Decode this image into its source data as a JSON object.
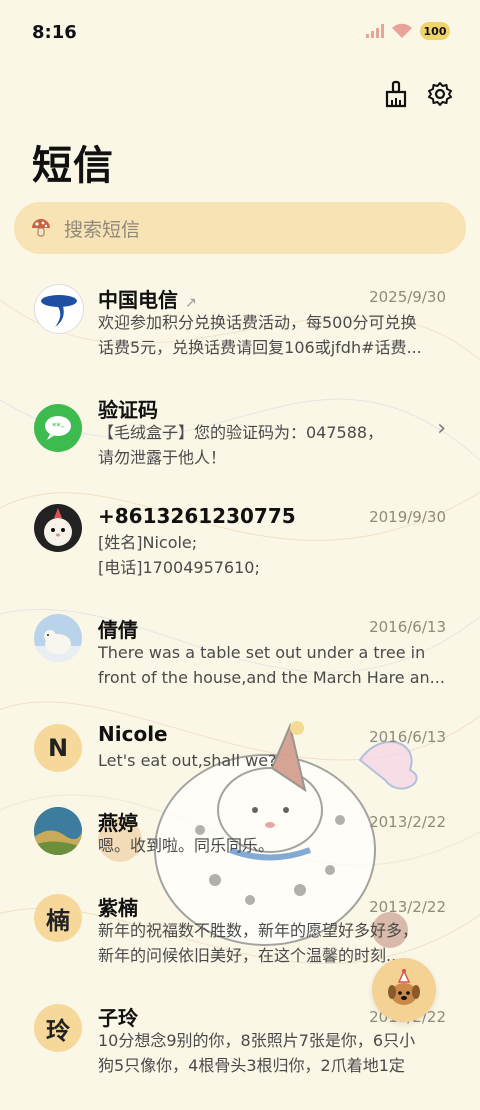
{
  "status": {
    "time": "8:16",
    "battery": "100"
  },
  "header": {
    "title": "短信"
  },
  "search": {
    "placeholder": "搜索短信"
  },
  "conversations": [
    {
      "name": "中国电信",
      "date": "2025/9/30",
      "line1": "欢迎参加积分兑换话费活动，每500分可兑换",
      "line2": "话费5元，兑换话费请回复106或jfdh#话费..."
    },
    {
      "name": "验证码",
      "date": "",
      "line1": "【毛绒盒子】您的验证码为：047588，",
      "line2": "请勿泄露于他人！"
    },
    {
      "name": "+8613261230775",
      "date": "2019/9/30",
      "line1": "[姓名]Nicole;",
      "line2": "[电话]17004957610;"
    },
    {
      "name": "倩倩",
      "date": "2016/6/13",
      "line1": "There was a table set out under a tree in",
      "line2": "front of the house,and the March Hare an..."
    },
    {
      "name": "Nicole",
      "avatar_letter": "N",
      "date": "2016/6/13",
      "line1": "Let's eat out,shall we?",
      "line2": ""
    },
    {
      "name": "燕婷",
      "date": "2013/2/22",
      "line1": "嗯。收到啦。同乐同乐。",
      "line2": ""
    },
    {
      "name": "紫楠",
      "avatar_letter": "楠",
      "date": "2013/2/22",
      "line1": "新年的祝福数不胜数，新年的愿望好多好多，",
      "line2": "新年的问候依旧美好，在这个温馨的时刻..."
    },
    {
      "name": "子玲",
      "avatar_letter": "玲",
      "date": "2013/2/22",
      "line1": "10分想念9别的你，8张照片7张是你，6只小",
      "line2": "狗5只像你，4根骨头3根归你，2爪着地1定"
    }
  ],
  "colors": {
    "background": "#fbf7e6",
    "search_bg": "#f7e3b3",
    "accent": "#f6d89a"
  }
}
